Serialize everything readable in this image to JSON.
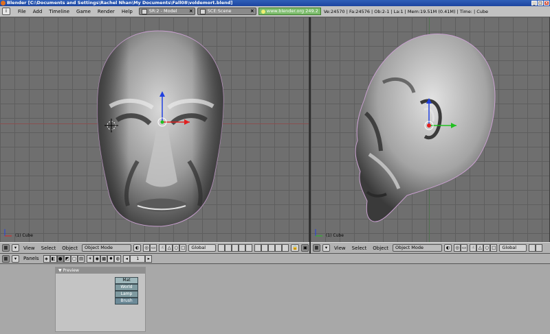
{
  "window": {
    "title": "Blender [C:\\Documents and Settings\\Rachel Nhan\\My Documents\\Fall08\\voldemort.blend]"
  },
  "menubar": {
    "menus": [
      "File",
      "Add",
      "Timeline",
      "Game",
      "Render",
      "Help"
    ],
    "screen_field": "SR:2 - Model",
    "scene_field": "SCE:Scene",
    "url": "www.blender.org 249.2",
    "stats": "Ve:24570 | Fa:24576 | Ob:2-1 | La:1  | Mem:19.51M (0.41M) | Time: | Cube"
  },
  "viewport_left": {
    "label": "(1) Cube"
  },
  "viewport_right": {
    "label": "(1) Cube"
  },
  "header_left": {
    "view": "View",
    "select": "Select",
    "object": "Object",
    "mode": "Object Mode",
    "orientation": "Global"
  },
  "header_right": {
    "view": "View",
    "select": "Select",
    "object": "Object",
    "mode": "Object Mode",
    "orientation": "Global"
  },
  "buttons_header": {
    "panels_label": "Panels",
    "frame_value": "1"
  },
  "preview_panel": {
    "title": "Preview",
    "buttons": [
      "Mat",
      "World",
      "Lamp",
      "Brush"
    ]
  },
  "colors": {
    "viewport_bg": "#6f6f6f",
    "grid": "#5e5e5e",
    "x_axis": "#e02020",
    "y_axis": "#20c020",
    "z_axis": "#2040e0"
  }
}
